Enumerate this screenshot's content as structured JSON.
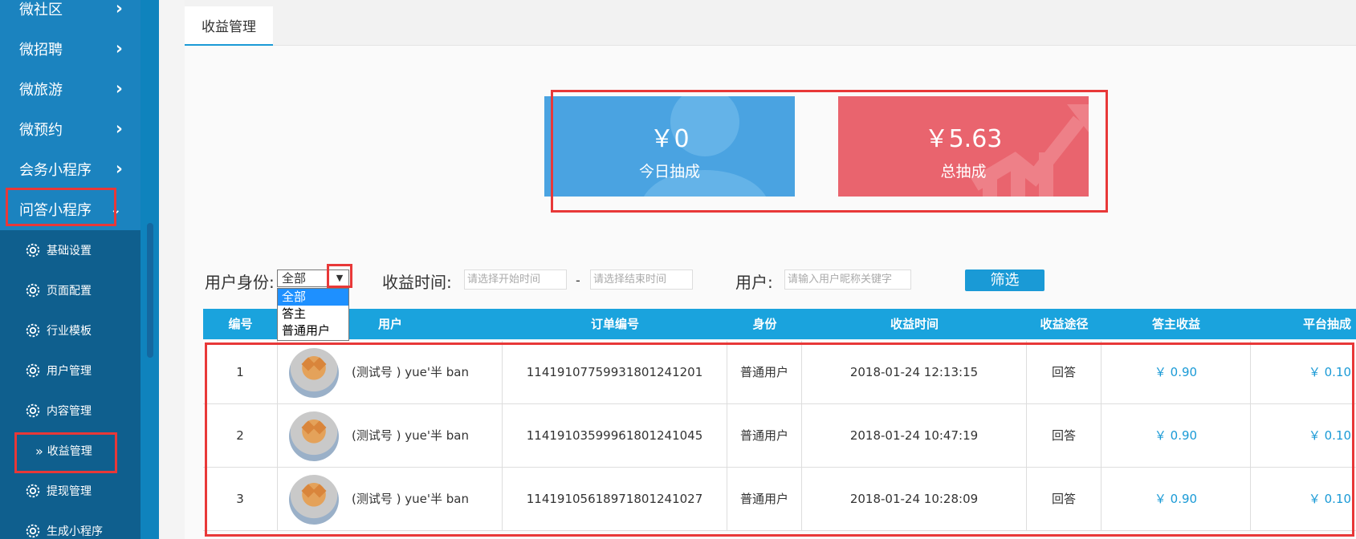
{
  "sidebar": {
    "menus": [
      {
        "label": "微社区"
      },
      {
        "label": "微招聘"
      },
      {
        "label": "微旅游"
      },
      {
        "label": "微预约"
      },
      {
        "label": "会务小程序"
      },
      {
        "label": "问答小程序"
      }
    ],
    "submenu": [
      {
        "label": "基础设置"
      },
      {
        "label": "页面配置"
      },
      {
        "label": "行业模板"
      },
      {
        "label": "用户管理"
      },
      {
        "label": "内容管理"
      },
      {
        "label": "收益管理"
      },
      {
        "label": "提现管理"
      },
      {
        "label": "生成小程序"
      }
    ],
    "chevron": "›",
    "chevron_open": "⌄",
    "active_arrow": "»"
  },
  "tab": {
    "label": "收益管理"
  },
  "stats": {
    "today": {
      "amount": "￥0",
      "label": "今日抽成"
    },
    "total": {
      "amount": "￥5.63",
      "label": "总抽成"
    }
  },
  "filter": {
    "identity_label": "用户身份:",
    "identity_value": "全部",
    "identity_arrow": "▼",
    "identity_options": [
      "全部",
      "答主",
      "普通用户"
    ],
    "time_label": "收益时间:",
    "start_placeholder": "请选择开始时间",
    "separator": "-",
    "end_placeholder": "请选择结束时间",
    "user_label": "用户:",
    "user_placeholder": "请输入用户昵称关键字",
    "button": "筛选"
  },
  "table": {
    "headers": [
      "编号",
      "用户",
      "订单编号",
      "身份",
      "收益时间",
      "收益途径",
      "答主收益",
      "平台抽成"
    ],
    "rows": [
      {
        "id": "1",
        "user": "(测试号 ) yue'半 ban",
        "order": "1141910775993180124120​1",
        "identity": "普通用户",
        "time": "2018-01-24 12:13:15",
        "route": "回答",
        "answerer": "￥ 0.90",
        "platform": "￥ 0.10"
      },
      {
        "id": "2",
        "user": "(测试号 ) yue'半 ban",
        "order": "11419103599961801241045",
        "identity": "普通用户",
        "time": "2018-01-24 10:47:19",
        "route": "回答",
        "answerer": "￥ 0.90",
        "platform": "￥ 0.10"
      },
      {
        "id": "3",
        "user": "(测试号 ) yue'半 ban",
        "order": "11419105618971801241027",
        "identity": "普通用户",
        "time": "2018-01-24 10:28:09",
        "route": "回答",
        "answerer": "￥ 0.90",
        "platform": "￥ 0.10"
      }
    ]
  },
  "colors": {
    "sidebar": "#1b83bf",
    "submenu": "#0f5f8e",
    "accent": "#1a9ad6",
    "blue_card": "#4aa3e1",
    "red_card": "#e9646e",
    "annotation": "#e83838"
  }
}
